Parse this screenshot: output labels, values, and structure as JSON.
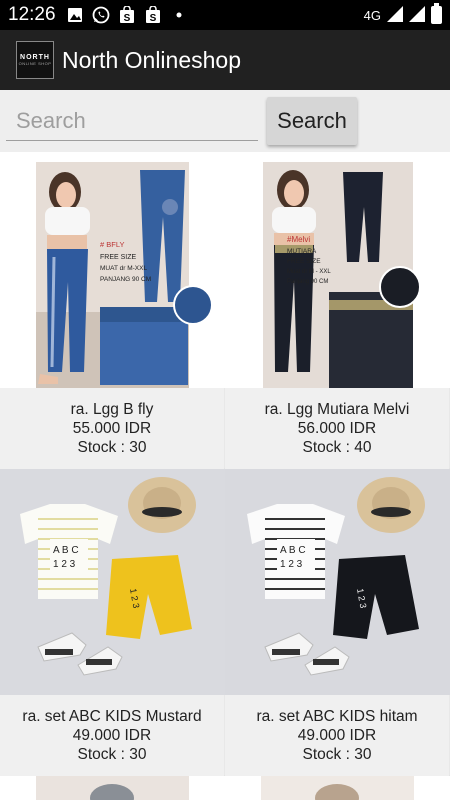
{
  "status_bar": {
    "time": "12:26",
    "network": "4G",
    "icons": [
      "image-icon",
      "whatsapp-icon",
      "shopping-bag-icon",
      "shopping-bag-icon",
      "dot-icon"
    ]
  },
  "app_bar": {
    "logo_text": "NORTH",
    "logo_subtext": "ONLINE SHOP",
    "title": "North Onlineshop"
  },
  "search": {
    "placeholder": "Search",
    "value": "",
    "button_label": "Search"
  },
  "products": [
    {
      "name": "ra. Lgg B fly",
      "price": "55.000 IDR",
      "stock": "Stock : 30",
      "image": "denim-leggings-photo",
      "image_text": [
        "# BFLY",
        "FREE SIZE",
        "MUAT dr M-XXL",
        "PANJANG 90 CM"
      ]
    },
    {
      "name": "ra. Lgg Mutiara Melvi",
      "price": "56.000 IDR",
      "stock": "Stock : 40",
      "image": "black-leggings-photo",
      "image_text": [
        "#Melvi",
        "MUTIARA",
        "FREE SIZE",
        "Muat dr M - XXL",
        "Panjang 90 CM"
      ]
    },
    {
      "name": "ra. set ABC KIDS Mustard",
      "price": "49.000 IDR",
      "stock": "Stock : 30",
      "image": "kids-set-mustard-photo",
      "image_text": [
        "A B C",
        "1 2 3",
        "1 2 3"
      ]
    },
    {
      "name": "ra. set ABC KIDS hitam",
      "price": "49.000 IDR",
      "stock": "Stock : 30",
      "image": "kids-set-black-photo",
      "image_text": [
        "A B C",
        "1 2 3",
        "1 2 3"
      ]
    }
  ],
  "colors": {
    "status_bar": "#000000",
    "app_bar": "#212121",
    "search_bg": "#eeeeee",
    "card_info_bg": "#f0f0f0"
  }
}
